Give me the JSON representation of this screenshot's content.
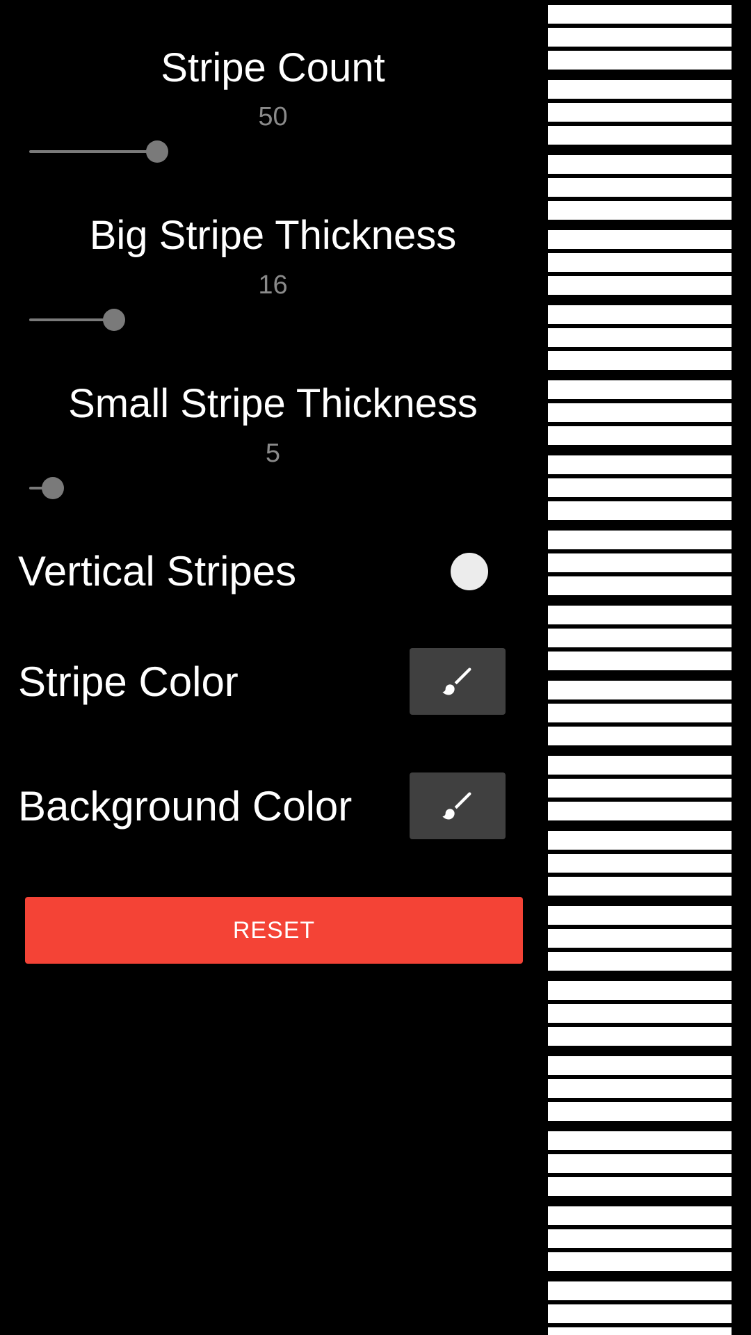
{
  "settings": {
    "stripe_count": {
      "title": "Stripe Count",
      "value_text": "50",
      "slider_fraction": 0.27
    },
    "big_stripe_thickness": {
      "title": "Big Stripe Thickness",
      "value_text": "16",
      "slider_fraction": 0.18
    },
    "small_stripe_thickness": {
      "title": "Small Stripe Thickness",
      "value_text": "5",
      "slider_fraction": 0.05
    },
    "vertical_stripes": {
      "label": "Vertical Stripes",
      "enabled": false
    },
    "stripe_color": {
      "label": "Stripe Color",
      "icon": "paintbrush-icon"
    },
    "background_color": {
      "label": "Background Color",
      "icon": "paintbrush-icon"
    },
    "reset_label": "RESET"
  },
  "preview": {
    "stripe_color": "#ffffff",
    "background_color": "#000000",
    "pattern": [
      "big",
      "big",
      "big",
      "gap"
    ]
  },
  "colors": {
    "page_background": "#000000",
    "accent": "#f44336",
    "slider": "#7a7a7a",
    "value_text": "#8a8a8a",
    "button_background": "#404040"
  }
}
